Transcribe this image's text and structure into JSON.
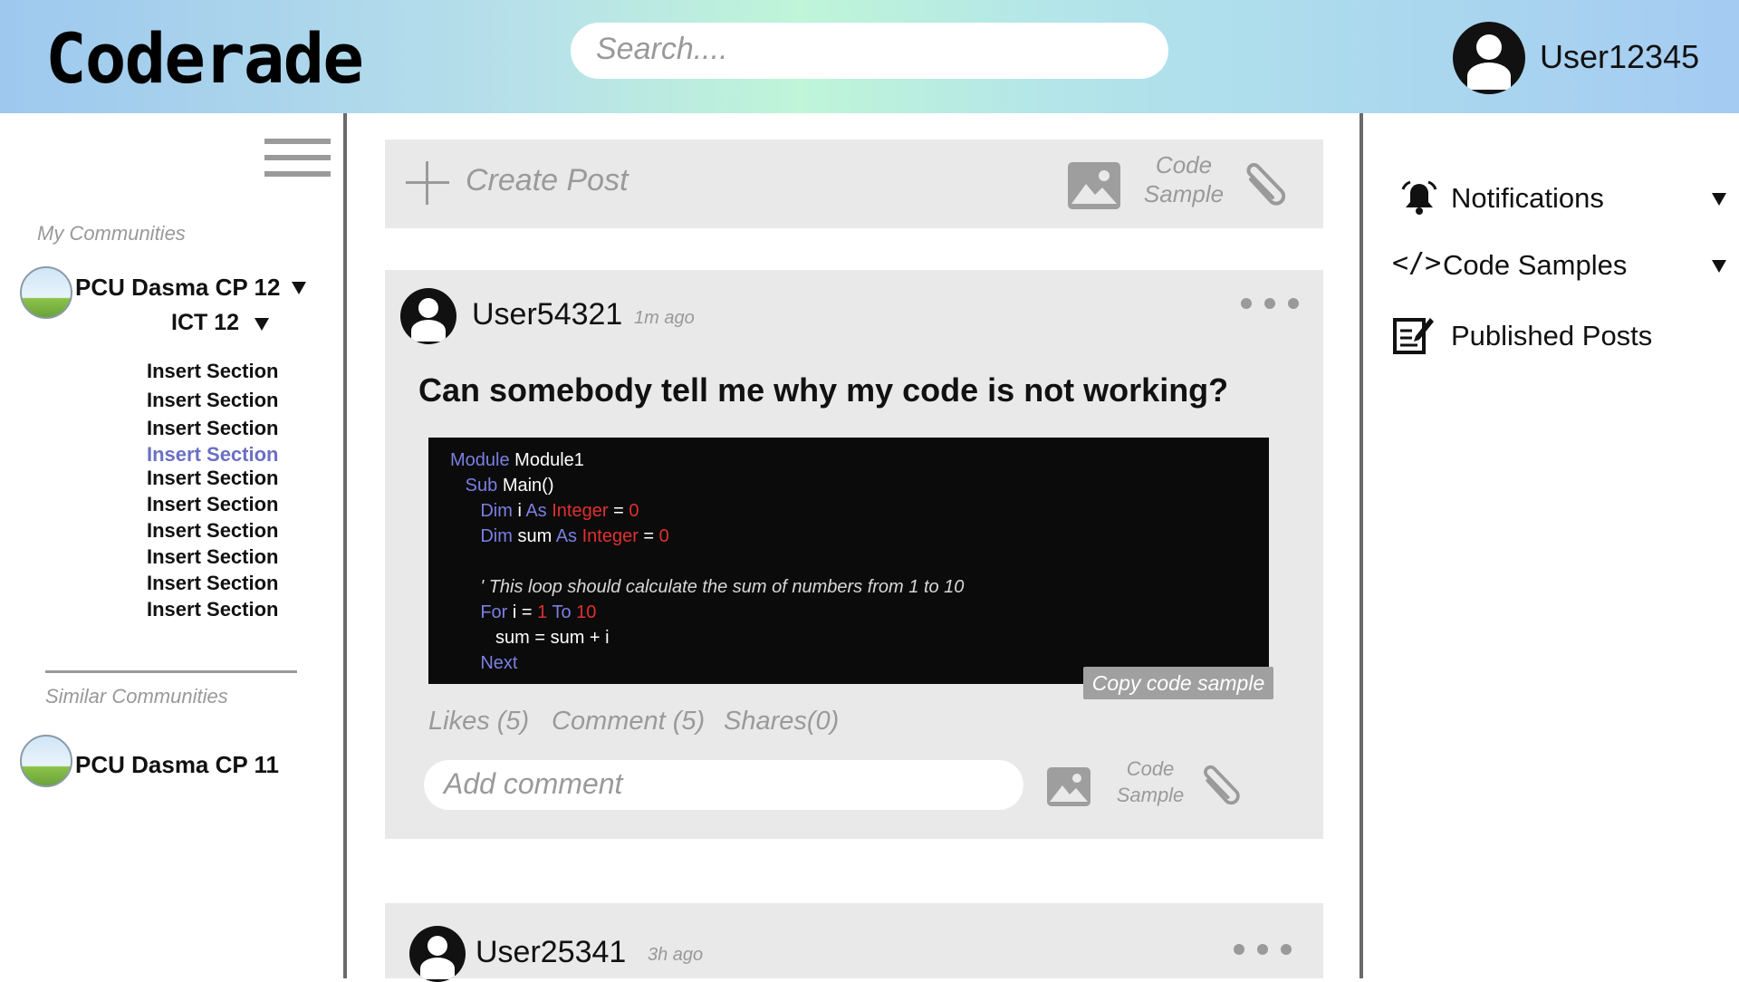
{
  "header": {
    "logo": "Coderade",
    "search_placeholder": "Search....",
    "user_name": "User12345"
  },
  "sidebar": {
    "my_communities_label": "My Communities",
    "community": {
      "name": "PCU Dasma CP 12",
      "sub_group": "ICT 12"
    },
    "sections": [
      "Insert Section",
      "Insert Section",
      "Insert Section",
      "Insert Section",
      "Insert Section",
      "Insert Section",
      "Insert Section",
      "Insert Section",
      "Insert Section",
      "Insert Section"
    ],
    "active_section_index": 3,
    "similar_communities_label": "Similar Communities",
    "similar_community": {
      "name": "PCU Dasma CP 11"
    }
  },
  "create_post": {
    "label": "Create Post",
    "code_sample_label_1": "Code",
    "code_sample_label_2": "Sample"
  },
  "posts": [
    {
      "user": "User54321",
      "time": "1m ago",
      "title": "Can somebody tell me why my code is not working?",
      "code_lines": [
        {
          "parts": [
            {
              "t": "Module",
              "c": "kw"
            },
            {
              "t": " Module1",
              "c": ""
            }
          ]
        },
        {
          "parts": [
            {
              "t": "   Sub",
              "c": "kw"
            },
            {
              "t": " Main()",
              "c": ""
            }
          ]
        },
        {
          "parts": [
            {
              "t": "      Dim",
              "c": "kw"
            },
            {
              "t": " i ",
              "c": ""
            },
            {
              "t": "As",
              "c": "kw"
            },
            {
              "t": " Integer",
              "c": "ty"
            },
            {
              "t": " = ",
              "c": ""
            },
            {
              "t": "0",
              "c": "num"
            }
          ]
        },
        {
          "parts": [
            {
              "t": "      Dim",
              "c": "kw"
            },
            {
              "t": " sum ",
              "c": ""
            },
            {
              "t": "As",
              "c": "kw"
            },
            {
              "t": " Integer",
              "c": "ty"
            },
            {
              "t": " = ",
              "c": ""
            },
            {
              "t": "0",
              "c": "num"
            }
          ]
        },
        {
          "parts": [
            {
              "t": "",
              "c": ""
            }
          ]
        },
        {
          "parts": [
            {
              "t": "      ' This loop should calculate the sum of numbers from 1 to 10",
              "c": "cm"
            }
          ]
        },
        {
          "parts": [
            {
              "t": "      For",
              "c": "kw"
            },
            {
              "t": " i = ",
              "c": ""
            },
            {
              "t": "1",
              "c": "num"
            },
            {
              "t": " To",
              "c": "kw"
            },
            {
              "t": " 10",
              "c": "num"
            }
          ]
        },
        {
          "parts": [
            {
              "t": "         sum = sum + i",
              "c": ""
            }
          ]
        },
        {
          "parts": [
            {
              "t": "      Next",
              "c": "kw"
            }
          ]
        }
      ],
      "copy_label": "Copy code sample",
      "likes": "Likes (5)",
      "comments": "Comment (5)",
      "shares": "Shares(0)",
      "comment_placeholder": "Add comment",
      "code_sample_label_1": "Code",
      "code_sample_label_2": "Sample"
    },
    {
      "user": "User25341",
      "time": "3h ago"
    }
  ],
  "right_panel": {
    "notifications": "Notifications",
    "code_samples": "Code Samples",
    "published_posts": "Published Posts"
  },
  "colors": {
    "keyword": "#7b7fe0",
    "type_number": "#e03030",
    "active_section": "#6b6fc4"
  }
}
